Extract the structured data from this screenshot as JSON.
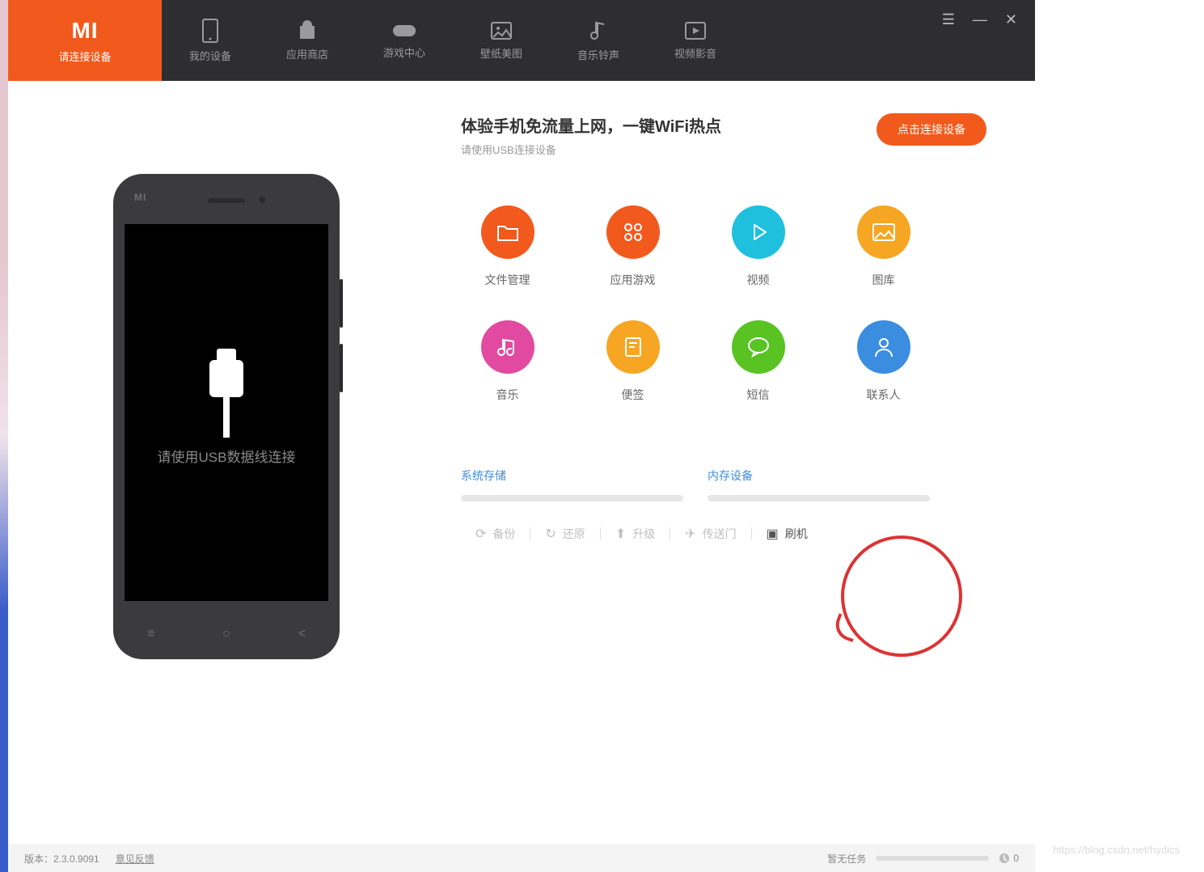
{
  "colors": {
    "accent": "#f25a1d",
    "blue": "#3b8de0",
    "green": "#58c322",
    "pink": "#e14aa0",
    "yellow": "#f6a623",
    "cyan": "#1fc0de",
    "night": "#2e2e30"
  },
  "nav": {
    "active_logo": "MI",
    "tabs": [
      {
        "label": "请连接设备",
        "icon": "mi-logo"
      },
      {
        "label": "我的设备",
        "icon": "device"
      },
      {
        "label": "应用商店",
        "icon": "store"
      },
      {
        "label": "游戏中心",
        "icon": "game"
      },
      {
        "label": "壁纸美图",
        "icon": "wallpaper"
      },
      {
        "label": "音乐铃声",
        "icon": "music"
      },
      {
        "label": "视频影音",
        "icon": "video"
      }
    ]
  },
  "phone": {
    "brand": "MI",
    "prompt": "请使用USB数据线连接"
  },
  "headline": {
    "title": "体验手机免流量上网，一键WiFi热点",
    "subtitle": "请使用USB连接设备",
    "button": "点击连接设备"
  },
  "features": [
    {
      "label": "文件管理",
      "color": "#f25a1d",
      "icon": "folder"
    },
    {
      "label": "应用游戏",
      "color": "#f25a1d",
      "icon": "apps"
    },
    {
      "label": "视频",
      "color": "#1fc0de",
      "icon": "play"
    },
    {
      "label": "图库",
      "color": "#f6a623",
      "icon": "image"
    },
    {
      "label": "音乐",
      "color": "#e14aa0",
      "icon": "note"
    },
    {
      "label": "便签",
      "color": "#f6a623",
      "icon": "note-page"
    },
    {
      "label": "短信",
      "color": "#58c322",
      "icon": "chat"
    },
    {
      "label": "联系人",
      "color": "#3b8de0",
      "icon": "person"
    }
  ],
  "storage": [
    {
      "label": "系统存储"
    },
    {
      "label": "内存设备"
    }
  ],
  "actions": [
    {
      "label": "备份",
      "icon": "refresh",
      "dark": false
    },
    {
      "label": "还原",
      "icon": "reload",
      "dark": false
    },
    {
      "label": "升级",
      "icon": "up",
      "dark": false
    },
    {
      "label": "传送门",
      "icon": "paper-plane",
      "dark": false
    },
    {
      "label": "刷机",
      "icon": "flash-box",
      "dark": true
    }
  ],
  "status": {
    "version_label": "版本：",
    "version": "2.3.0.9091",
    "feedback": "意见反馈",
    "task": "暂无任务",
    "task_count": "0"
  },
  "watermark": "https://blog.csdn.net/hydics"
}
